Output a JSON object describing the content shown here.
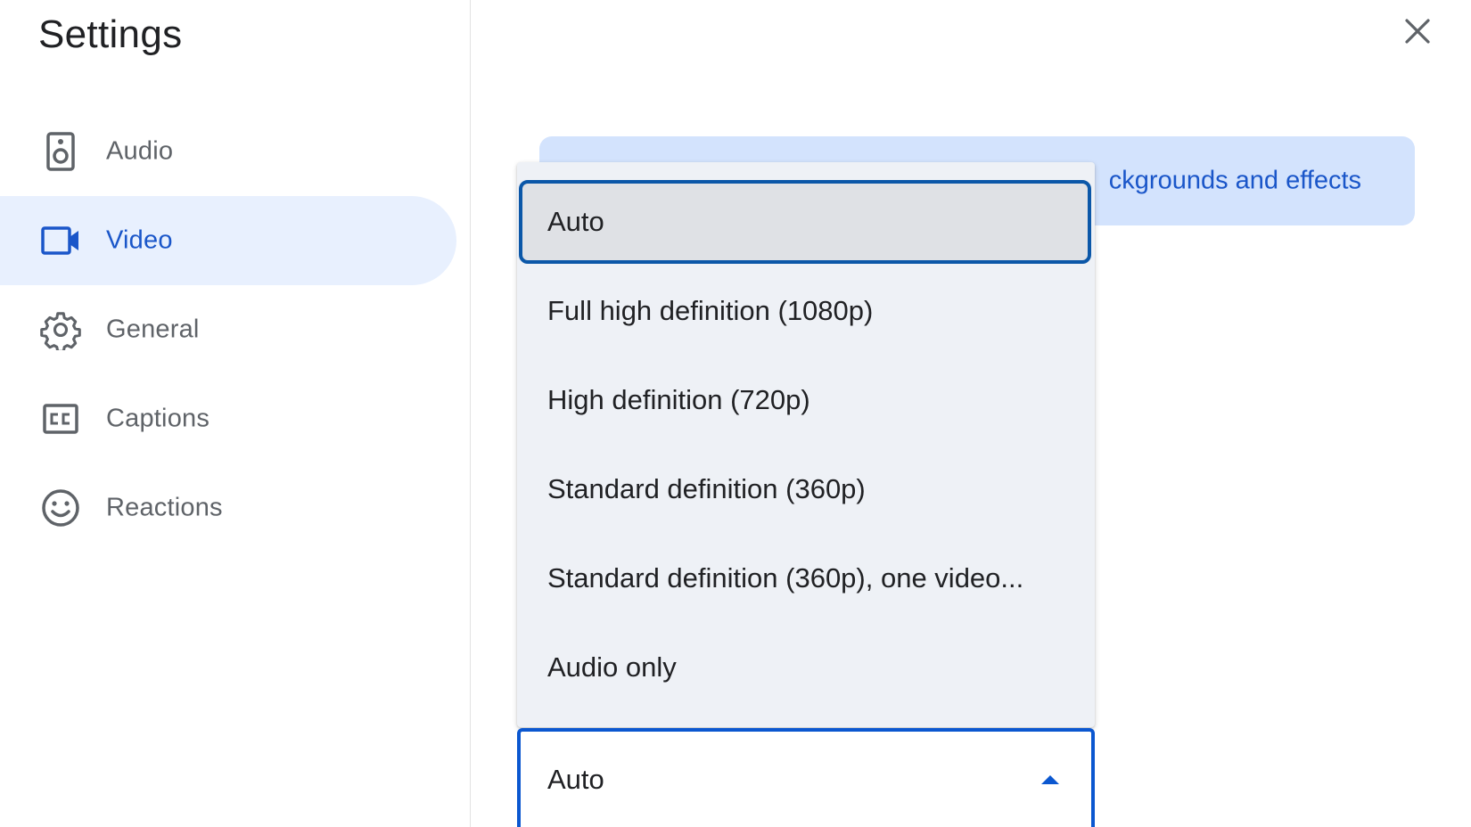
{
  "dialog": {
    "title": "Settings",
    "close_icon": "close-icon"
  },
  "sidebar": {
    "items": [
      {
        "label": "Audio",
        "icon": "speaker-icon",
        "active": false
      },
      {
        "label": "Video",
        "icon": "videocam-icon",
        "active": true
      },
      {
        "label": "General",
        "icon": "gear-icon",
        "active": false
      },
      {
        "label": "Captions",
        "icon": "closed-captions-icon",
        "active": false
      },
      {
        "label": "Reactions",
        "icon": "smiley-icon",
        "active": false
      }
    ]
  },
  "banner": {
    "text": "ckgrounds and effects"
  },
  "resolution_menu": {
    "options": [
      {
        "label": "Auto",
        "selected": true
      },
      {
        "label": "Full high definition (1080p)",
        "selected": false
      },
      {
        "label": "High definition (720p)",
        "selected": false
      },
      {
        "label": "Standard definition (360p)",
        "selected": false
      },
      {
        "label": "Standard definition (360p), one video...",
        "selected": false
      },
      {
        "label": "Audio only",
        "selected": false
      }
    ]
  },
  "resolution_select": {
    "value": "Auto",
    "caret_icon": "caret-up-icon"
  },
  "colors": {
    "accent": "#0b57d0",
    "active_nav_bg": "#e8f0fe",
    "banner_bg": "#d3e3fd",
    "menu_bg": "#eef1f6"
  }
}
